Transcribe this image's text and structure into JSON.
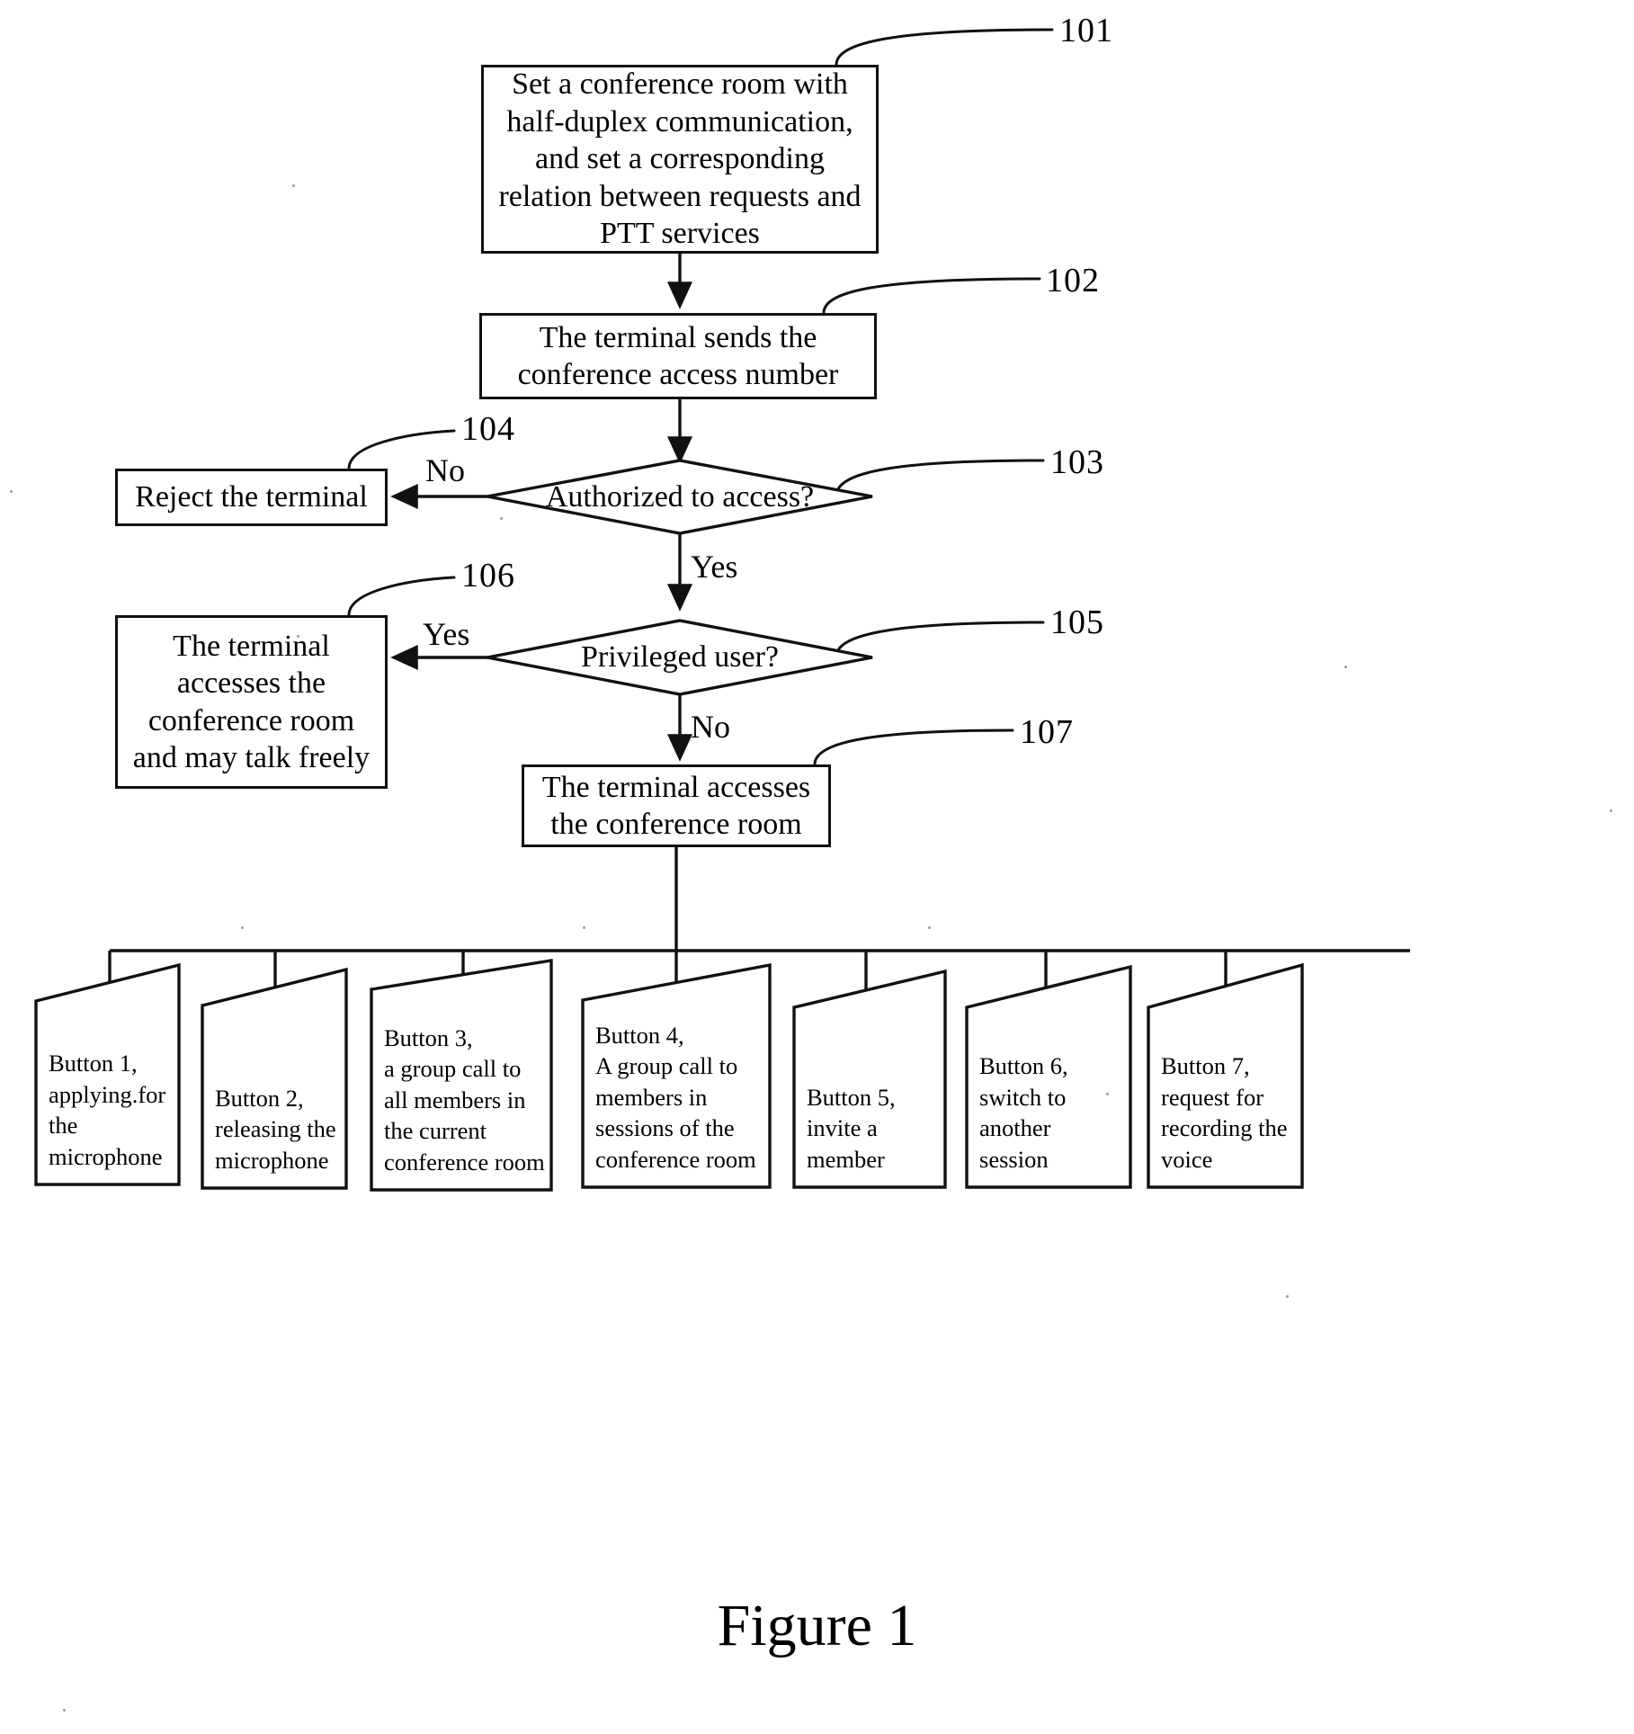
{
  "figure": {
    "caption": "Figure 1"
  },
  "nodes": {
    "n101": {
      "ref": "101",
      "text": "Set a conference room with half-duplex communication, and set a corresponding relation between requests and PTT services"
    },
    "n102": {
      "ref": "102",
      "text": "The terminal sends the conference access number"
    },
    "n103": {
      "ref": "103",
      "text": "Authorized to access?"
    },
    "n104": {
      "ref": "104",
      "text": "Reject the terminal"
    },
    "n105": {
      "ref": "105",
      "text": "Privileged user?"
    },
    "n106": {
      "ref": "106",
      "text": "The terminal accesses the conference room and may talk freely"
    },
    "n107": {
      "ref": "107",
      "text": "The terminal accesses the conference room"
    }
  },
  "edge_labels": {
    "no_103": "No",
    "yes_103": "Yes",
    "yes_105": "Yes",
    "no_105": "No"
  },
  "buttons": [
    {
      "title": "Button 1,",
      "desc": "applying.for the microphone"
    },
    {
      "title": "Button 2,",
      "desc": "releasing the microphone"
    },
    {
      "title": "Button 3,",
      "desc": "a group call to all members in the current conference room"
    },
    {
      "title": "Button 4,",
      "desc": "A group call  to members in sessions of the conference room"
    },
    {
      "title": "Button 5,",
      "desc": "invite a member"
    },
    {
      "title": "Button 6,",
      "desc": "switch to another session"
    },
    {
      "title": "Button 7,",
      "desc": "request for recording the voice"
    }
  ],
  "style": {
    "ink": "#111111",
    "paper": "#ffffff"
  }
}
